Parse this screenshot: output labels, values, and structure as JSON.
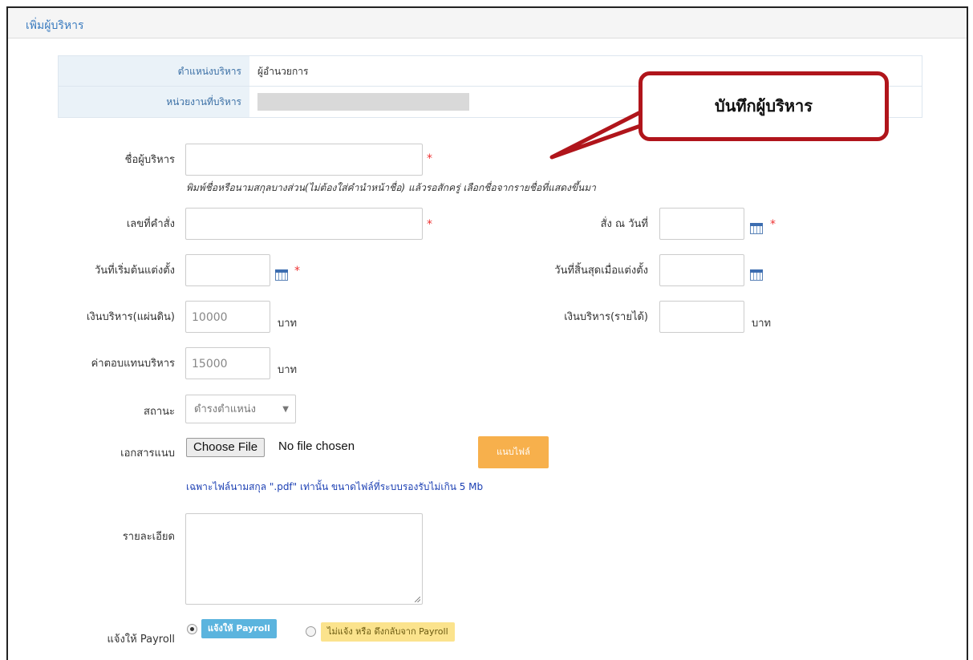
{
  "panel": {
    "title": "เพิ่มผู้บริหาร"
  },
  "info": {
    "position_label": "ตำแหน่งบริหาร",
    "position_value": "ผู้อำนวยการ",
    "unit_label": "หน่วยงานที่บริหาร"
  },
  "callout": {
    "text": "บันทึกผู้บริหาร"
  },
  "form": {
    "name_label": "ชื่อผู้บริหาร",
    "name_hint": "พิมพ์ชื่อหรือนามสกุลบางส่วน(ไม่ต้องใส่คำนำหน้าชื่อ) แล้วรอสักครู่ เลือกชื่อจากรายชื่อที่แสดงขึ้นมา",
    "order_no_label": "เลขที่คำสั่ง",
    "order_date_label": "สั่ง ณ วันที่",
    "start_date_label": "วันที่เริ่มต้นแต่งตั้ง",
    "end_date_label": "วันที่สิ้นสุดเมื่อแต่งตั้ง",
    "allowance_land_label": "เงินบริหาร(แผ่นดิน)",
    "allowance_land_value": "10000",
    "allowance_income_label": "เงินบริหาร(รายได้)",
    "compensation_label": "ค่าตอบแทนบริหาร",
    "compensation_value": "15000",
    "currency_unit": "บาท",
    "status_label": "สถานะ",
    "status_value": "ดำรงตำแหน่ง",
    "attachment_label": "เอกสารแนบ",
    "choose_file": "Choose File",
    "no_file": "No file chosen",
    "attach_button": "แนบไฟล์",
    "file_note": "เฉพาะไฟล์นามสกุล \".pdf\" เท่านั้น ขนาดไฟล์ที่ระบบรองรับไม่เกิน 5 Mb",
    "detail_label": "รายละเอียด",
    "payroll_label": "แจ้งให้ Payroll",
    "payroll_notify": "แจ้งให้ Payroll",
    "payroll_withdraw": "ไม่แจ้ง หรือ ดึงกลับจาก Payroll",
    "required_mark": "*"
  },
  "colors": {
    "accent": "#3a7bbf",
    "required": "#e33333",
    "attach_button": "#f7b04c",
    "notify_badge": "#5bb4de",
    "withdraw_badge": "#fbe38d",
    "callout_border": "#b0151b"
  },
  "icons": {
    "calendar": "calendar-icon",
    "dropdown": "chevron-down-icon"
  }
}
